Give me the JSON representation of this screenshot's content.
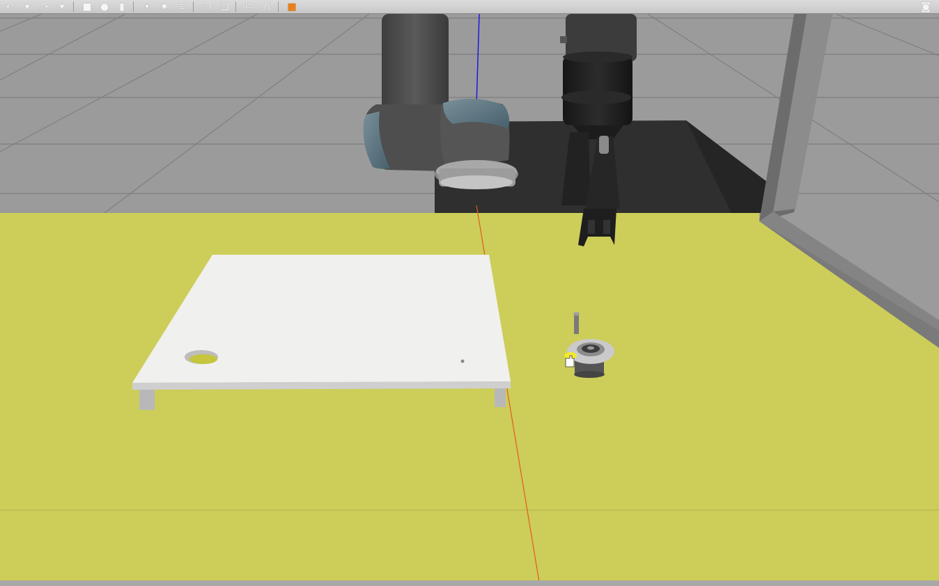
{
  "window": {
    "app": "Gazebo simulation viewport"
  },
  "toolbar": {
    "left_tools": [
      {
        "name": "undo-icon",
        "glyph": "↶"
      },
      {
        "name": "undo-history-icon",
        "glyph": "▾"
      },
      {
        "name": "redo-icon",
        "glyph": "↷"
      },
      {
        "name": "redo-history-icon",
        "glyph": "▾"
      },
      {
        "name": "box-shape-icon",
        "glyph": "■"
      },
      {
        "name": "sphere-shape-icon",
        "glyph": "●"
      },
      {
        "name": "cylinder-shape-icon",
        "glyph": "▮"
      },
      {
        "name": "point-light-icon",
        "glyph": "☀"
      },
      {
        "name": "spot-light-icon",
        "glyph": "✺"
      },
      {
        "name": "directional-light-icon",
        "glyph": "≋"
      },
      {
        "name": "copy-icon",
        "glyph": "❐"
      },
      {
        "name": "paste-icon",
        "glyph": "❏"
      },
      {
        "name": "align-icon",
        "glyph": "⊨"
      },
      {
        "name": "snap-icon",
        "glyph": "∩"
      },
      {
        "name": "change-view-icon",
        "glyph": "■"
      }
    ],
    "right_tools": [
      {
        "name": "screenshot-icon",
        "glyph": "◙"
      }
    ],
    "colors": {
      "background": "#d4d4d4",
      "icon": "#f5f5f5",
      "view_accent": "#e8801c"
    }
  },
  "scene": {
    "colors": {
      "sky_ground": "#9a9a9a",
      "floor_mat": "#cccc5a",
      "table_top": "#f0f0ee",
      "robot_link": "#4a4a4a",
      "robot_joint_cap": "#5e7480",
      "gripper": "#1f1f1f",
      "robot_pedestal": "#2e2e2e",
      "wall_frame": "#7a7a7a",
      "fixture_ring": "#c9c9c9",
      "highlight_marker": "#f2ea2a",
      "axis_x": "#e35a1a",
      "axis_z": "#1a1ae0"
    },
    "objects": [
      "ur-robot-arm",
      "robotiq-gripper",
      "robot-pedestal",
      "work-table",
      "floor-mat",
      "wall-frame",
      "bearing-fixture",
      "peg-part"
    ]
  }
}
